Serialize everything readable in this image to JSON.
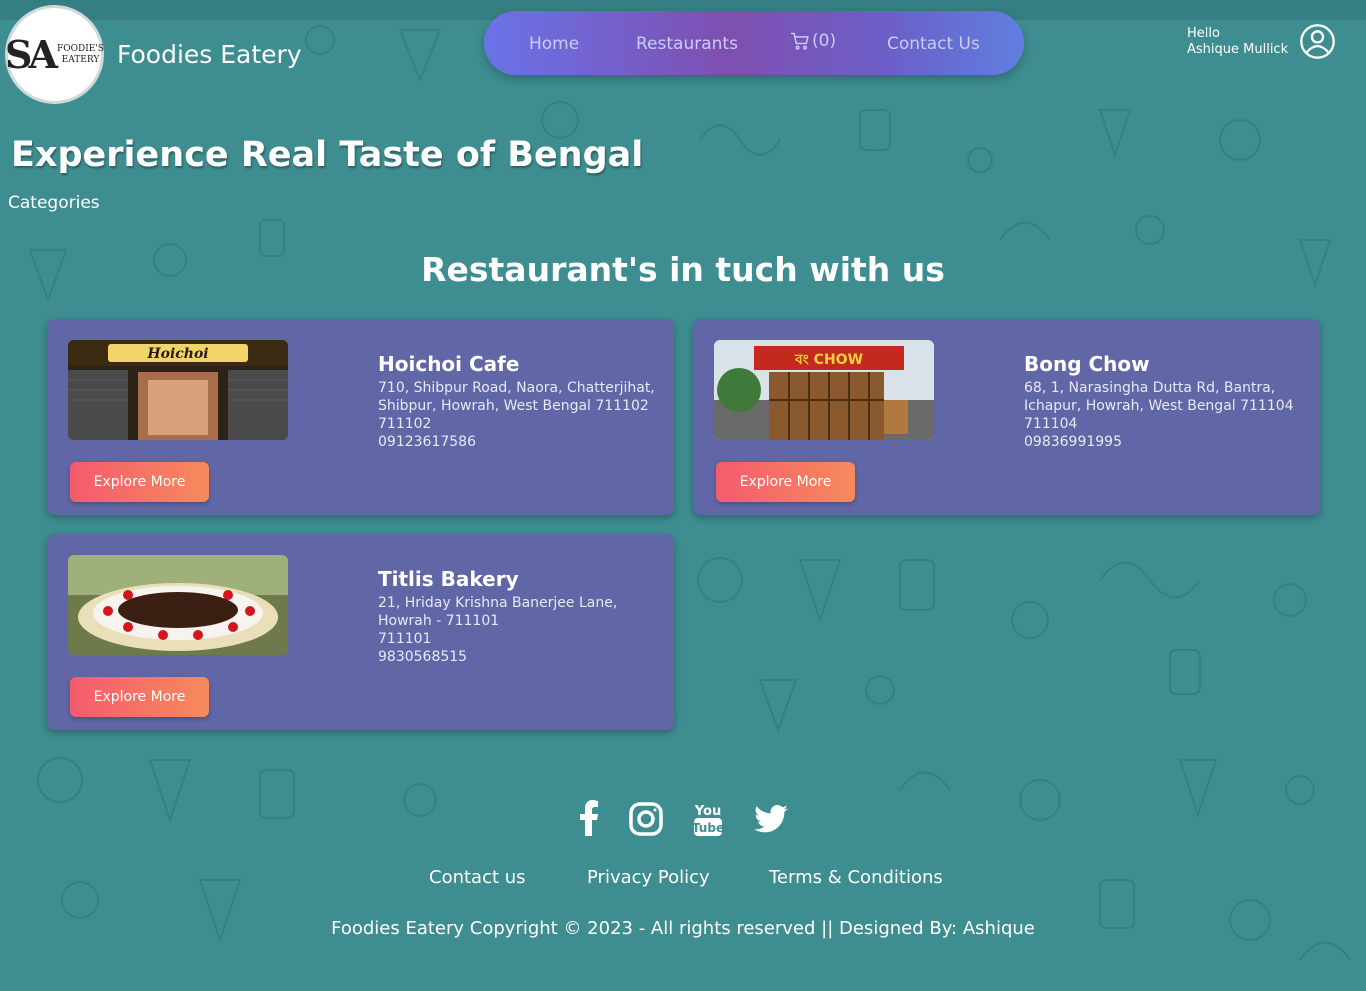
{
  "header": {
    "brand_name": "Foodies Eatery",
    "logo": {
      "monogram": "SA",
      "line1": "FOODIE'S",
      "line2": "EATERY"
    },
    "nav": {
      "home": "Home",
      "restaurants": "Restaurants",
      "cart_count": "(0)",
      "contact": "Contact Us"
    },
    "user": {
      "greeting": "Hello",
      "name": "Ashique Mullick"
    }
  },
  "hero": {
    "title": "Experience Real Taste of Bengal",
    "categories_label": "Categories"
  },
  "section": {
    "title": "Restaurant's in tuch with us"
  },
  "restaurants": [
    {
      "name": "Hoichoi Cafe",
      "address": "710, Shibpur Road, Naora, Chatterjihat, Shibpur, Howrah, West Bengal 711102",
      "pin": "711102",
      "phone": "09123617586",
      "button": "Explore More",
      "image_sign": "Hoichoi"
    },
    {
      "name": "Bong Chow",
      "address": "68, 1, Narasingha Dutta Rd, Bantra, Ichapur, Howrah, West Bengal 711104",
      "pin": "711104",
      "phone": "09836991995",
      "button": "Explore More",
      "image_sign": "বং CHOW"
    },
    {
      "name": "Titlis Bakery",
      "address": "21, Hriday Krishna Banerjee Lane, Howrah - 711101",
      "pin": "711101",
      "phone": "9830568515",
      "button": "Explore More"
    }
  ],
  "footer": {
    "links": {
      "contact": "Contact us",
      "privacy": "Privacy Policy",
      "terms": "Terms & Conditions"
    },
    "copyright": "Foodies Eatery Copyright © 2023 - All rights reserved || Designed By: Ashique",
    "social_icons": [
      "facebook-icon",
      "instagram-icon",
      "youtube-icon",
      "twitter-icon"
    ]
  },
  "colors": {
    "background": "#3e8e91",
    "card": "#6167a6",
    "button_start": "#f45b6e",
    "button_end": "#f78a5c",
    "nav_gradient_start": "#6a73e8",
    "nav_gradient_mid": "#7e4fb0"
  }
}
